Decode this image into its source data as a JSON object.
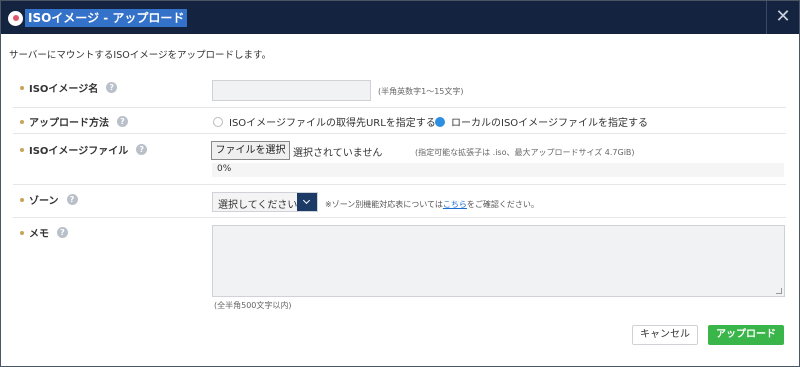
{
  "dialog": {
    "title": "ISOイメージ - アップロード",
    "close_icon": "close-icon",
    "intro": "サーバーにマウントするISOイメージをアップロードします。"
  },
  "form": {
    "name": {
      "label": "ISOイメージ名",
      "value": "",
      "hint": "(半角英数字1〜15文字)"
    },
    "method": {
      "label": "アップロード方法",
      "options": [
        {
          "label": "ISOイメージファイルの取得先URLを指定する",
          "selected": false
        },
        {
          "label": "ローカルのISOイメージファイルを指定する",
          "selected": true
        }
      ]
    },
    "file": {
      "label": "ISOイメージファイル",
      "button": "ファイルを選択",
      "status": "選択されていません",
      "hint": "(指定可能な拡張子は .iso、最大アップロードサイズ 4.7GiB)",
      "progress_text": "0%",
      "progress": 0
    },
    "zone": {
      "label": "ゾーン",
      "selected": "選択してください",
      "note_before": "※ゾーン別機能対応表については",
      "note_link": "こちら",
      "note_after": "をご確認ください。"
    },
    "memo": {
      "label": "メモ",
      "value": "",
      "hint": "(全半角500文字以内)"
    }
  },
  "footer": {
    "cancel": "キャンセル",
    "upload": "アップロード"
  },
  "colors": {
    "titlebar": "#142440",
    "title_highlight": "#3471c8",
    "accent_dot": "#c8a35a",
    "radio_selected": "#2c8fe0",
    "upload_button": "#3ab54a",
    "select_arrow": "#1c3a66",
    "link": "#1a6fd1"
  }
}
